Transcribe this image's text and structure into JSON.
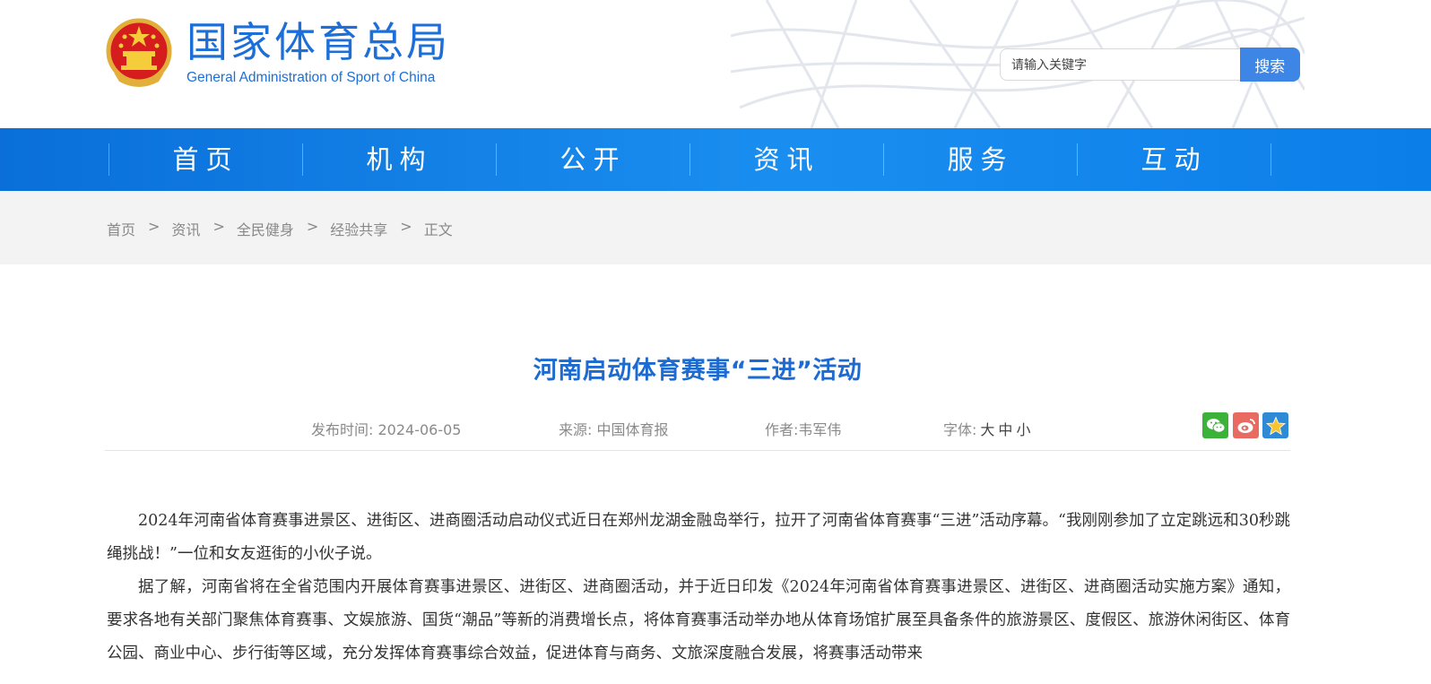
{
  "site": {
    "name_cn": "国家体育总局",
    "name_en": "General Administration of Sport of China"
  },
  "search": {
    "placeholder": "请输入关键字",
    "button_label": "搜索"
  },
  "nav": {
    "items": [
      "首页",
      "机构",
      "公开",
      "资讯",
      "服务",
      "互动"
    ]
  },
  "breadcrumb": {
    "items": [
      "首页",
      "资讯",
      "全民健身",
      "经验共享",
      "正文"
    ],
    "separator": ">"
  },
  "article": {
    "title": "河南启动体育赛事“三进”活动",
    "publish_label": "发布时间:",
    "publish_date": "2024-06-05",
    "source_label": "来源:",
    "source": "中国体育报",
    "author_label": "作者:",
    "author": "韦军伟",
    "font_label": "字体:",
    "font_sizes": [
      "大",
      "中",
      "小"
    ],
    "share_icons": [
      "wechat-icon",
      "weibo-icon",
      "favorite-star-icon"
    ],
    "paragraphs": [
      "2024年河南省体育赛事进景区、进街区、进商圈活动启动仪式近日在郑州龙湖金融岛举行，拉开了河南省体育赛事“三进”活动序幕。“我刚刚参加了立定跳远和30秒跳绳挑战！”一位和女友逛街的小伙子说。",
      "据了解，河南省将在全省范围内开展体育赛事进景区、进街区、进商圈活动，并于近日印发《2024年河南省体育赛事进景区、进街区、进商圈活动实施方案》通知，要求各地有关部门聚焦体育赛事、文娱旅游、国货“潮品”等新的消费增长点，将体育赛事活动举办地从体育场馆扩展至具备条件的旅游景区、度假区、旅游休闲街区、体育公园、商业中心、步行街等区域，充分发挥体育赛事综合效益，促进体育与商务、文旅深度融合发展，将赛事活动带来"
    ]
  },
  "colors": {
    "brand_blue": "#1c6fd8",
    "nav_blue": "#0a6fd9",
    "title_blue": "#1d6bd1",
    "search_button": "#3d86e6"
  }
}
